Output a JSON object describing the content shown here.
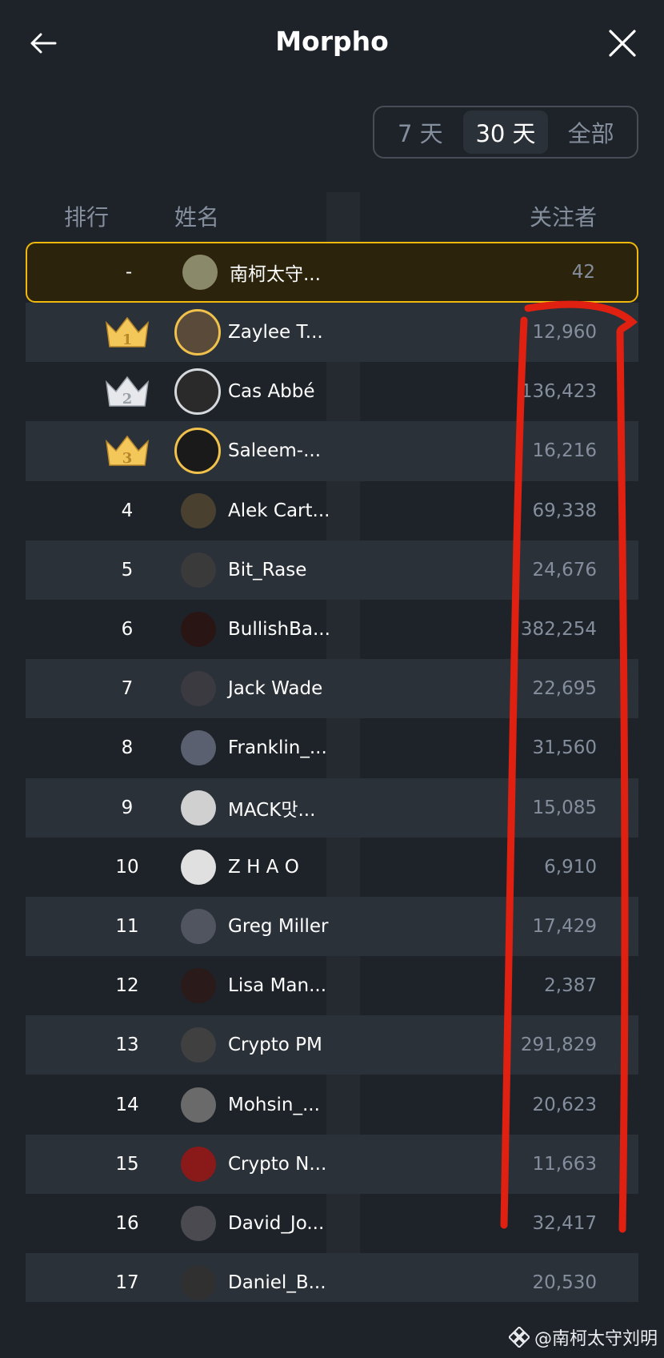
{
  "header": {
    "title": "Morpho"
  },
  "period_tabs": [
    "7 天",
    "30 天",
    "全部"
  ],
  "active_tab": 1,
  "columns": {
    "rank": "排行",
    "name": "姓名",
    "followers": "关注者"
  },
  "me": {
    "rank": "-",
    "name": "南柯太守...",
    "followers": "42"
  },
  "rows": [
    {
      "rank": "1",
      "name": "Zaylee T...",
      "followers": "12,960"
    },
    {
      "rank": "2",
      "name": "Cas Abbé",
      "followers": "136,423"
    },
    {
      "rank": "3",
      "name": "Saleem-...",
      "followers": "16,216"
    },
    {
      "rank": "4",
      "name": "Alek Cart...",
      "followers": "69,338"
    },
    {
      "rank": "5",
      "name": "Bit_Rase",
      "followers": "24,676"
    },
    {
      "rank": "6",
      "name": "BullishBa...",
      "followers": "382,254"
    },
    {
      "rank": "7",
      "name": "Jack Wade",
      "followers": "22,695"
    },
    {
      "rank": "8",
      "name": "Franklin_...",
      "followers": "31,560"
    },
    {
      "rank": "9",
      "name": "MACK맛...",
      "followers": "15,085"
    },
    {
      "rank": "10",
      "name": "Z H A O",
      "followers": "6,910"
    },
    {
      "rank": "11",
      "name": "Greg Miller",
      "followers": "17,429"
    },
    {
      "rank": "12",
      "name": "Lisa Man...",
      "followers": "2,387"
    },
    {
      "rank": "13",
      "name": "Crypto PM",
      "followers": "291,829"
    },
    {
      "rank": "14",
      "name": "Mohsin_...",
      "followers": "20,623"
    },
    {
      "rank": "15",
      "name": "Crypto N...",
      "followers": "11,663"
    },
    {
      "rank": "16",
      "name": "David_Jo...",
      "followers": "32,417"
    },
    {
      "rank": "17",
      "name": "Daniel_B...",
      "followers": "20,530"
    }
  ],
  "watermark": "@南柯太守刘明",
  "colors": {
    "background": "#1e2329",
    "row_alt": "#2b3139",
    "highlight_border": "#f0b90b",
    "annotation": "#e02010",
    "gold": "#f0c14b",
    "silver": "#d5d8dc"
  }
}
